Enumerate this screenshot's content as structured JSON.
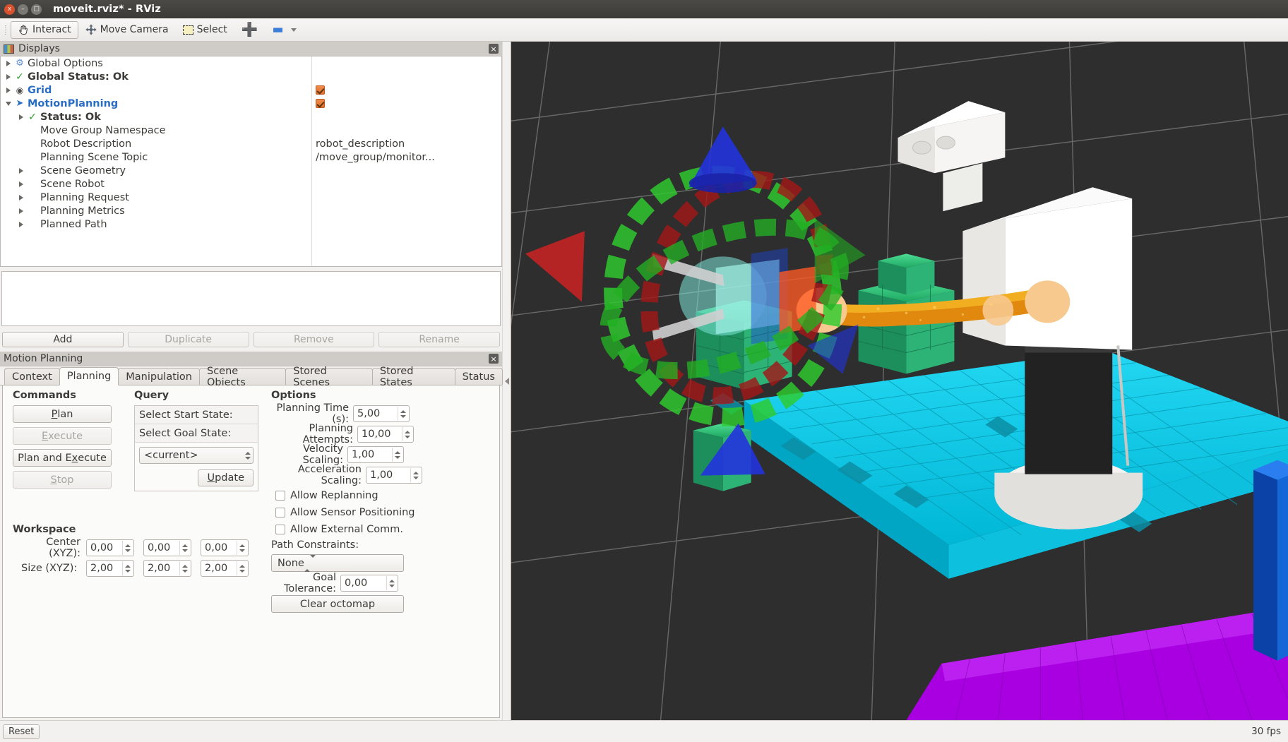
{
  "window": {
    "title": "moveit.rviz* - RViz",
    "buttons": {
      "close": "x",
      "minimize": "–",
      "maximize": "□"
    }
  },
  "toolbar": {
    "items": [
      {
        "label": "Interact",
        "icon": "hand-cursor-icon",
        "active": true
      },
      {
        "label": "Move Camera",
        "icon": "move-camera-icon",
        "active": false
      },
      {
        "label": "Select",
        "icon": "select-box-icon",
        "active": false
      },
      {
        "label": "",
        "icon": "plus-icon",
        "active": false
      },
      {
        "label": "",
        "icon": "minus-icon",
        "active": false
      }
    ]
  },
  "displays_panel": {
    "title": "Displays",
    "close_label": "×",
    "tree": [
      {
        "label": "Global Options",
        "icon": "gear-icon",
        "arrow": "right",
        "indent": 0,
        "style": "normal",
        "value": ""
      },
      {
        "label": "Global Status: Ok",
        "icon": "check-icon",
        "arrow": "right",
        "indent": 0,
        "style": "bold",
        "value": ""
      },
      {
        "label": "Grid",
        "icon": "eye-icon",
        "arrow": "right",
        "indent": 0,
        "style": "blue",
        "value": "checkbox"
      },
      {
        "label": "MotionPlanning",
        "icon": "motion-planning-icon",
        "arrow": "down",
        "indent": 0,
        "style": "blue",
        "value": "checkbox"
      },
      {
        "label": "Status: Ok",
        "icon": "check-icon",
        "arrow": "right",
        "indent": 1,
        "style": "bold",
        "value": ""
      },
      {
        "label": "Move Group Namespace",
        "icon": "",
        "arrow": "none",
        "indent": 1,
        "style": "normal",
        "value": ""
      },
      {
        "label": "Robot Description",
        "icon": "",
        "arrow": "none",
        "indent": 1,
        "style": "normal",
        "value": "robot_description"
      },
      {
        "label": "Planning Scene Topic",
        "icon": "",
        "arrow": "none",
        "indent": 1,
        "style": "normal",
        "value": "/move_group/monitor..."
      },
      {
        "label": "Scene Geometry",
        "icon": "",
        "arrow": "right",
        "indent": 1,
        "style": "normal",
        "value": ""
      },
      {
        "label": "Scene Robot",
        "icon": "",
        "arrow": "right",
        "indent": 1,
        "style": "normal",
        "value": ""
      },
      {
        "label": "Planning Request",
        "icon": "",
        "arrow": "right",
        "indent": 1,
        "style": "normal",
        "value": ""
      },
      {
        "label": "Planning Metrics",
        "icon": "",
        "arrow": "right",
        "indent": 1,
        "style": "normal",
        "value": ""
      },
      {
        "label": "Planned Path",
        "icon": "",
        "arrow": "right",
        "indent": 1,
        "style": "normal",
        "value": ""
      }
    ],
    "buttons": [
      {
        "label": "Add",
        "enabled": true
      },
      {
        "label": "Duplicate",
        "enabled": false
      },
      {
        "label": "Remove",
        "enabled": false
      },
      {
        "label": "Rename",
        "enabled": false
      }
    ]
  },
  "motion_planning_panel": {
    "title": "Motion Planning",
    "close_label": "×",
    "tabs": [
      {
        "label": "Context",
        "selected": false
      },
      {
        "label": "Planning",
        "selected": true
      },
      {
        "label": "Manipulation",
        "selected": false
      },
      {
        "label": "Scene Objects",
        "selected": false
      },
      {
        "label": "Stored Scenes",
        "selected": false
      },
      {
        "label": "Stored States",
        "selected": false
      },
      {
        "label": "Status",
        "selected": false
      }
    ],
    "commands": {
      "title": "Commands",
      "buttons": [
        {
          "label": "Plan",
          "mnemonic_index": 1,
          "enabled": true
        },
        {
          "label": "Execute",
          "mnemonic_index": 1,
          "enabled": false
        },
        {
          "label": "Plan and Execute",
          "mnemonic_index": 11,
          "enabled": true
        },
        {
          "label": "Stop",
          "mnemonic_index": 1,
          "enabled": false
        }
      ]
    },
    "query": {
      "title": "Query",
      "start_state_label": "Select Start State:",
      "goal_state_label": "Select Goal State:",
      "selected_state": "<current>",
      "update_button": "Update",
      "update_mnemonic_index": 0
    },
    "options": {
      "title": "Options",
      "fields": [
        {
          "label": "Planning Time (s):",
          "value": "5,00"
        },
        {
          "label": "Planning Attempts:",
          "value": "10,00"
        },
        {
          "label": "Velocity Scaling:",
          "value": "1,00"
        },
        {
          "label": "Acceleration Scaling:",
          "value": "1,00"
        }
      ],
      "checkboxes": [
        {
          "label": "Allow Replanning",
          "checked": false
        },
        {
          "label": "Allow Sensor Positioning",
          "checked": false
        },
        {
          "label": "Allow External Comm.",
          "checked": false
        }
      ],
      "path_constraints_label": "Path Constraints:",
      "path_constraints_value": "None",
      "goal_tolerance_label": "Goal Tolerance:",
      "goal_tolerance_value": "0,00",
      "clear_octomap_label": "Clear octomap"
    },
    "workspace": {
      "title": "Workspace",
      "center_label": "Center (XYZ):",
      "center_values": [
        "0,00",
        "0,00",
        "0,00"
      ],
      "size_label": "Size (XYZ):",
      "size_values": [
        "2,00",
        "2,00",
        "2,00"
      ]
    }
  },
  "statusbar": {
    "reset_label": "Reset",
    "fps_label": "30 fps"
  },
  "colors": {
    "accent_blue": "#2a6ec4",
    "checkbox_orange": "#e2702c",
    "status_green": "#2f9e2f",
    "octomap_cyan": "#00c8e6",
    "octomap_purple": "#a800e0",
    "octomap_green": "#2fbf6f",
    "viewport_background": "#2e2e2e",
    "marker_red": "#cc2222",
    "marker_green": "#22aa22",
    "marker_blue": "#2233cc",
    "robot_arm_orange": "#e08a14"
  }
}
